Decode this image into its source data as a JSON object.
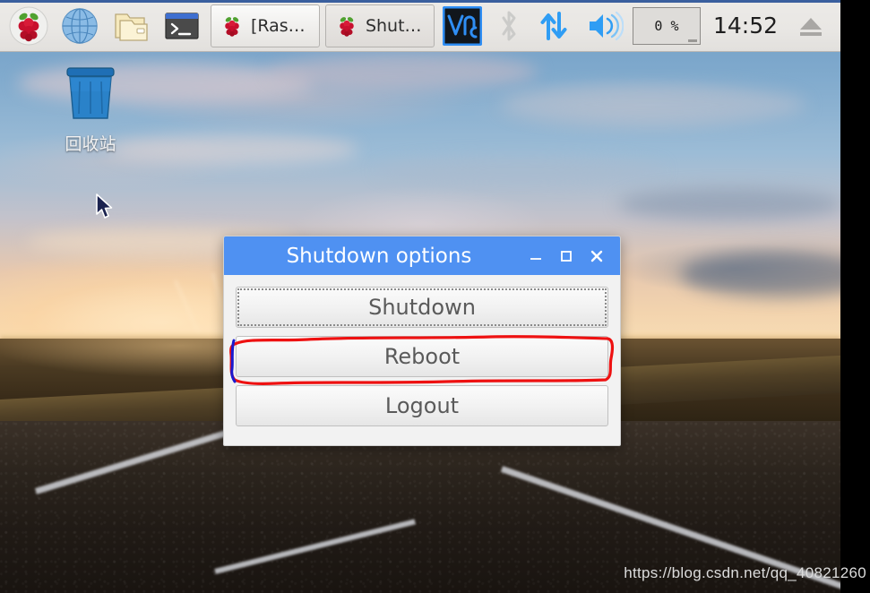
{
  "taskbar": {
    "launchers": [
      {
        "name": "raspberry-menu",
        "icon": "raspberry-icon",
        "label": "Raspberry Pi Menu"
      },
      {
        "name": "web-browser",
        "icon": "globe-icon",
        "label": "Web Browser"
      },
      {
        "name": "file-manager",
        "icon": "folder-icon",
        "label": "File Manager"
      },
      {
        "name": "terminal",
        "icon": "terminal-icon",
        "label": "Terminal"
      }
    ],
    "windows": [
      {
        "label": "[Ras…",
        "icon": "raspberry-icon",
        "active": true
      },
      {
        "label": "Shut…",
        "icon": "raspberry-icon",
        "active": false
      }
    ],
    "tray": {
      "vnc_label": "VNC",
      "bluetooth_icon": "bluetooth-icon",
      "network_icon": "network-updown-icon",
      "volume_icon": "volume-icon",
      "cpu_value": "0 %",
      "clock": "14:52",
      "eject_icon": "eject-icon"
    },
    "colors": {
      "accent": "#3a5f9e",
      "background": "#eceae7",
      "vnc_blue": "#2f8ef4"
    }
  },
  "desktop": {
    "icon_label": "回收站",
    "icon_name": "recycle-bin-icon",
    "wallpaper_description": "road at sunset"
  },
  "dialog": {
    "title": "Shutdown options",
    "titlebar_color": "#4f91f2",
    "buttons": [
      {
        "label": "Shutdown",
        "focused": true
      },
      {
        "label": "Reboot",
        "focused": false
      },
      {
        "label": "Logout",
        "focused": false
      }
    ],
    "controls": {
      "minimize": "–",
      "maximize": "▢",
      "close": "✕"
    }
  },
  "annotation": {
    "highlight_target": "Reboot",
    "stroke_color": "#ee1111",
    "secondary_color": "#1a1ad0"
  },
  "watermark": {
    "text": "https://blog.csdn.net/qq_40821260"
  }
}
